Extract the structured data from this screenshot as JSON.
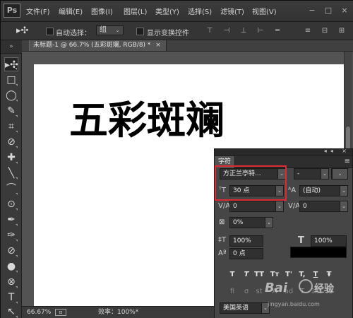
{
  "app": {
    "logo": "Ps",
    "menu": [
      "文件(F)",
      "编辑(E)",
      "图像(I)",
      "图层(L)",
      "类型(Y)",
      "选择(S)",
      "滤镜(T)",
      "视图(V)"
    ],
    "window_controls": [
      "−",
      "□",
      "×"
    ]
  },
  "options": {
    "tool_preset": "▸✣",
    "auto_select_label": "自动选择：",
    "auto_select_value": "组",
    "transform_label": "显示变换控件",
    "align_icons": [
      "⊤",
      "⊣",
      "⊥",
      "⊢",
      "═",
      "≡",
      "⊟",
      "⊞"
    ]
  },
  "tools": [
    "▸✣",
    "□",
    "◯",
    "✎",
    "⌗",
    "⊘",
    "✚",
    "╲",
    "⌒",
    "⊙",
    "✒",
    "✑",
    "⊘",
    "●",
    "⊗",
    "T",
    "↖"
  ],
  "document": {
    "tab_title": "未标题-1 @ 66.7% (五彩斑斓, RGB/8) *",
    "close": "×",
    "canvas_text": "五彩斑斓",
    "zoom": "66.67%",
    "status_icon": "⊡",
    "efficiency": "效率：100%*"
  },
  "character_panel": {
    "tab_label": "字符",
    "menu_icon": "≡",
    "font_family": "方正兰亭特...",
    "font_style": "-",
    "font_size": "30 点",
    "leading": "(自动)",
    "kerning": "0",
    "tracking": "0",
    "scale_percent": "0%",
    "vertical_scale": "100%",
    "horizontal_scale": "100%",
    "baseline_shift": "0 点",
    "color_label": "颜色：",
    "language": "美国英语",
    "style_buttons": [
      "T",
      "T",
      "TT",
      "Tт",
      "T'",
      "T,",
      "T",
      "Ŧ"
    ],
    "ot_buttons": [
      "fi",
      "σ",
      "st",
      "A",
      "ad",
      "T",
      "1st",
      "½"
    ]
  },
  "watermark": {
    "main": "Bai",
    "cn": "经验",
    "url": "jingyan.baidu.com"
  },
  "colors": {
    "highlight": "#de2a33",
    "canvas": "#ffffff",
    "text": "#000000"
  }
}
